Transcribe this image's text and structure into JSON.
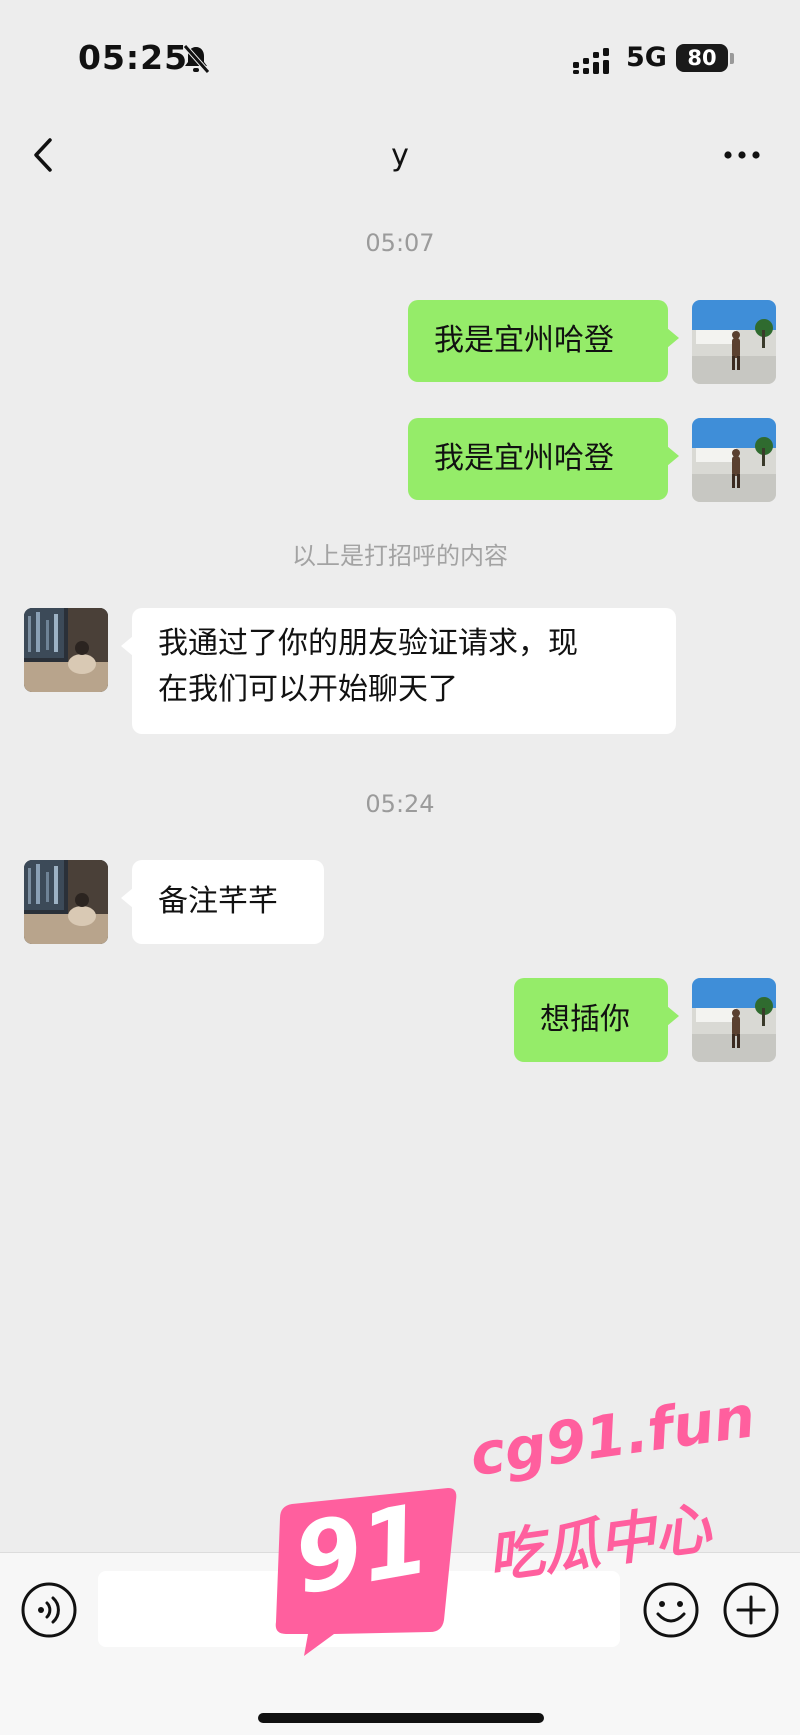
{
  "status_bar": {
    "time": "05:25",
    "network": "5G",
    "battery": "80"
  },
  "nav": {
    "title": "y"
  },
  "messages": {
    "timestamp_1": "05:07",
    "out_1": "我是宜州哈登",
    "out_2": "我是宜州哈登",
    "system_notice": "以上是打招呼的内容",
    "in_1_line_1": "我通过了你的朋友验证请求，现",
    "in_1_line_2": "在我们可以开始聊天了",
    "timestamp_2": "05:24",
    "in_2": "备注芊芊",
    "out_3": "想插你"
  },
  "input_bar": {
    "placeholder": ""
  },
  "watermark": {
    "url": "cg91.fun",
    "brand_cn": "吃瓜中心",
    "badge": "91"
  },
  "colors": {
    "background": "#ededed",
    "outgoing_bubble": "#95ec69",
    "incoming_bubble": "#ffffff",
    "watermark": "#ff5f9e"
  },
  "icons": [
    "bell-off-icon",
    "signal-icon",
    "back-icon",
    "more-icon",
    "voice-icon",
    "emoji-icon",
    "add-icon"
  ]
}
